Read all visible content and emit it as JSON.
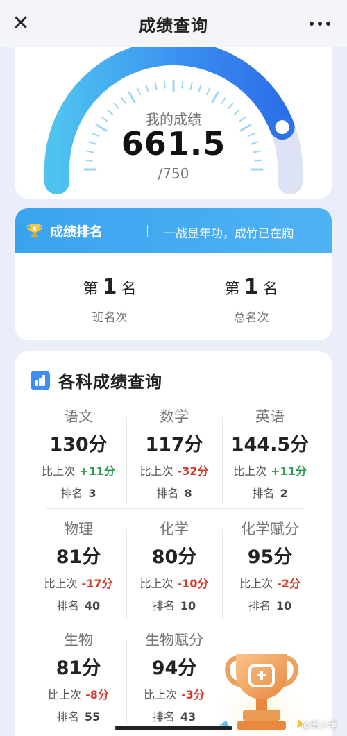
{
  "header": {
    "title": "成绩查询"
  },
  "gauge": {
    "label": "我的成绩",
    "score": "661.5",
    "total": "/750",
    "fraction": 0.882
  },
  "ranking": {
    "title": "成绩排名",
    "slogan": "一战显年功，成竹已在胸",
    "class_rank": {
      "prefix": "第",
      "value": "1",
      "suffix": "名",
      "label": "班名次"
    },
    "total_rank": {
      "prefix": "第",
      "value": "1",
      "suffix": "名",
      "label": "总名次"
    }
  },
  "subjects": {
    "title": "各科成绩查询",
    "compare_label": "比上次",
    "rank_label": "排名",
    "items": [
      {
        "name": "语文",
        "score": "130分",
        "change": "+11分",
        "rank": "3"
      },
      {
        "name": "数学",
        "score": "117分",
        "change": "-32分",
        "rank": "8"
      },
      {
        "name": "英语",
        "score": "144.5分",
        "change": "+11分",
        "rank": "2"
      },
      {
        "name": "物理",
        "score": "81分",
        "change": "-17分",
        "rank": "40"
      },
      {
        "name": "化学",
        "score": "80分",
        "change": "-10分",
        "rank": "10"
      },
      {
        "name": "化学赋分",
        "score": "95分",
        "change": "-2分",
        "rank": "10"
      },
      {
        "name": "生物",
        "score": "81分",
        "change": "-8分",
        "rank": "55"
      },
      {
        "name": "生物赋分",
        "score": "94分",
        "change": "-3分",
        "rank": "43"
      }
    ]
  },
  "watermark": "@周少境",
  "colors": {
    "accent": "#3aa3ef",
    "gauge_start": "#4fc3f0",
    "gauge_end": "#2d6fe8",
    "gauge_track": "#dde3f5",
    "increase": "#2f9a4f",
    "decrease": "#d23a2c"
  }
}
